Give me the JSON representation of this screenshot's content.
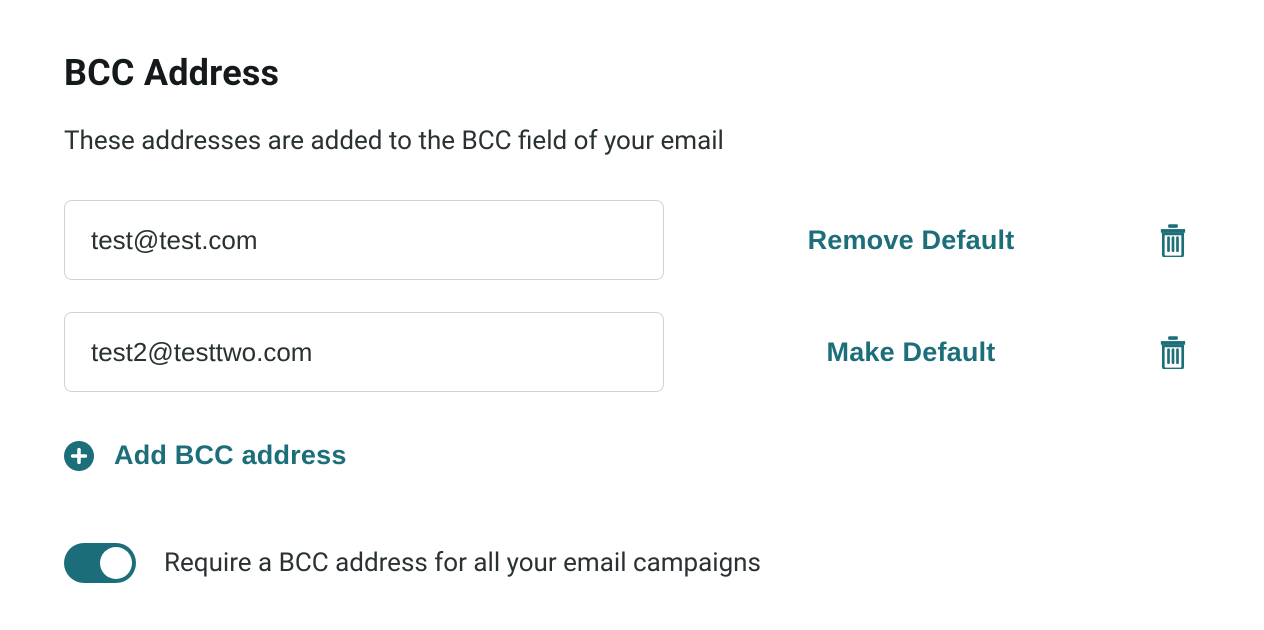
{
  "section": {
    "title": "BCC Address",
    "description": "These addresses are added to the BCC field of your email"
  },
  "bcc_rows": [
    {
      "email": "test@test.com",
      "action_label": "Remove Default"
    },
    {
      "email": "test2@testtwo.com",
      "action_label": "Make Default"
    }
  ],
  "add_button_label": "Add BCC address",
  "require_toggle": {
    "label": "Require a BCC address for all your email campaigns",
    "on": true
  },
  "colors": {
    "teal": "#1b6e7a",
    "text": "#1b2022",
    "border": "#cfd3d4"
  }
}
